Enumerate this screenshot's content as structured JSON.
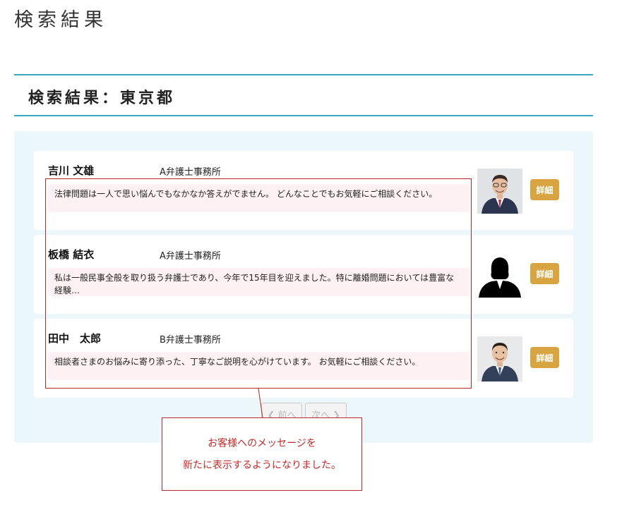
{
  "page": {
    "title": "検索結果"
  },
  "section": {
    "title": "検索結果：東京都"
  },
  "results": [
    {
      "name": "吉川 文雄",
      "office": "A弁護士事務所",
      "message": "法律問題は一人で思い悩んでもなかなか答えがでません。 どんなことでもお気軽にご相談ください。",
      "photo_icon": "lawyer-photo-male-glasses",
      "detail_label": "詳細"
    },
    {
      "name": "板橋 結衣",
      "office": "A弁護士事務所",
      "message": "私は一般民事全般を取り扱う弁護士であり、今年で15年目を迎えました。特に離婚問題においては豊富な経験…",
      "photo_icon": "silhouette-female-icon",
      "detail_label": "詳細"
    },
    {
      "name": "田中　太郎",
      "office": "B弁護士事務所",
      "message": "相談者さまのお悩みに寄り添った、丁寧なご説明を心がけています。 お気軽にご相談ください。",
      "photo_icon": "lawyer-photo-male-smiling",
      "detail_label": "詳細"
    }
  ],
  "pagination": {
    "prev_label": "前へ",
    "next_label": "次へ"
  },
  "callout": {
    "line1": "お客様へのメッセージを",
    "line2": "新たに表示するようになりました。"
  },
  "colors": {
    "accent_line": "#3aa6bf",
    "panel_bg": "#ebf7fb",
    "message_bg": "#fdf1f3",
    "detail_button": "#d7a441",
    "annotation_red": "#b22a2a"
  }
}
